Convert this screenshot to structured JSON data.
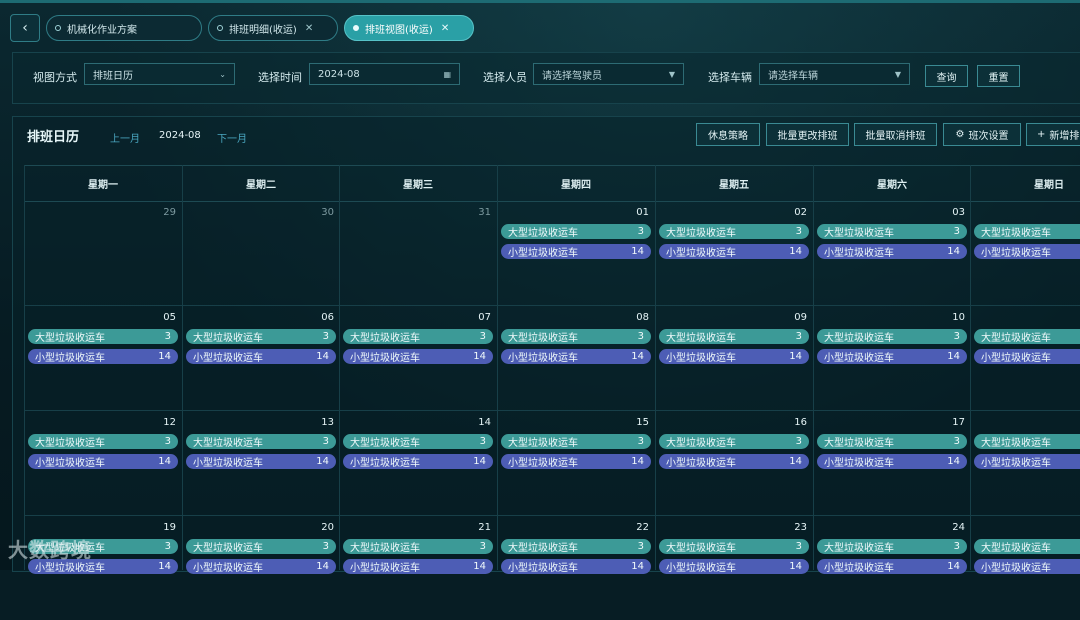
{
  "tabs": [
    {
      "label": "机械化作业方案",
      "active": false,
      "closable": false
    },
    {
      "label": "排班明细(收运)",
      "active": false,
      "closable": true
    },
    {
      "label": "排班视图(收运)",
      "active": true,
      "closable": true
    }
  ],
  "filters": {
    "view_mode_label": "视图方式",
    "view_mode_value": "排班日历",
    "time_label": "选择时间",
    "time_value": "2024-08",
    "person_label": "选择人员",
    "person_placeholder": "请选择驾驶员",
    "vehicle_label": "选择车辆",
    "vehicle_placeholder": "请选择车辆",
    "query_btn": "查询",
    "reset_btn": "重置"
  },
  "calendar": {
    "title": "排班日历",
    "prev": "上一月",
    "current": "2024-08",
    "next": "下一月",
    "toolbar": [
      "休息策略",
      "批量更改排班",
      "批量取消排班",
      "班次设置",
      "新增排"
    ],
    "weekdays": [
      "星期一",
      "星期二",
      "星期三",
      "星期四",
      "星期五",
      "星期六",
      "星期日"
    ],
    "big_label": "大型垃圾收运车",
    "big_count": "3",
    "small_label": "小型垃圾收运车",
    "small_count": "14",
    "weeks": [
      [
        "29",
        "30",
        "31",
        "01",
        "02",
        "03",
        ""
      ],
      [
        "05",
        "06",
        "07",
        "08",
        "09",
        "10",
        ""
      ],
      [
        "12",
        "13",
        "14",
        "15",
        "16",
        "17",
        ""
      ],
      [
        "19",
        "20",
        "21",
        "22",
        "23",
        "24",
        ""
      ]
    ]
  },
  "watermark": "大数跨境"
}
